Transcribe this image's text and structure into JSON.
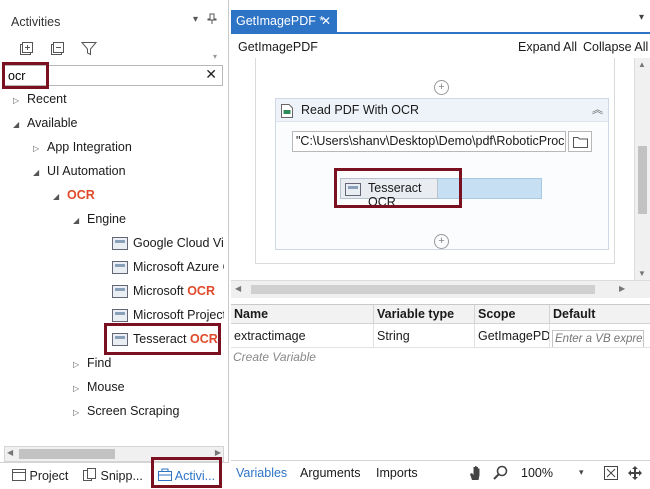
{
  "activities_panel": {
    "title": "Activities",
    "pin_glyphs": "▾ ⊥",
    "search": {
      "value": "ocr",
      "clear": "✕"
    },
    "tree": {
      "recent": "Recent",
      "available": "Available",
      "app_integration": "App Integration",
      "ui_automation": "UI Automation",
      "ocr": "OCR",
      "engine": "Engine",
      "google_cloud": "Google Cloud Vis",
      "microsoft_azure": "Microsoft Azure C",
      "microsoft_prefix": "Microsoft ",
      "microsoft_ocr_hl": "OCR",
      "microsoft_project": "Microsoft Project",
      "tesseract_prefix": "Tesseract ",
      "tesseract_ocr_hl": "OCR",
      "find": "Find",
      "mouse": "Mouse",
      "screen_scraping": "Screen Scraping"
    },
    "bottom_tabs": {
      "project": "Project",
      "snippets": "Snipp...",
      "activities": "Activi..."
    }
  },
  "document": {
    "tab_label": "GetImagePDF *",
    "tab_close": "✕",
    "breadcrumb": "GetImagePDF",
    "expand_all": "Expand All",
    "collapse_all": "Collapse All",
    "activity_title": "Read PDF With OCR",
    "file_path": "\"C:\\Users\\shanv\\Desktop\\Demo\\pdf\\RoboticProc",
    "engine_label": "Tesseract OCR"
  },
  "variables": {
    "headers": {
      "name": "Name",
      "type": "Variable type",
      "scope": "Scope",
      "default": "Default"
    },
    "row": {
      "name": "extractimage",
      "type": "String",
      "scope": "GetImagePDF",
      "default_placeholder": "Enter a VB expres"
    },
    "create_label": "Create Variable",
    "bottom_tabs": {
      "variables": "Variables",
      "arguments": "Arguments",
      "imports": "Imports"
    },
    "zoom": "100%"
  },
  "colors": {
    "accent": "#2e74c6",
    "highlight": "#7a1020",
    "ocr_text": "#e04a2a"
  }
}
